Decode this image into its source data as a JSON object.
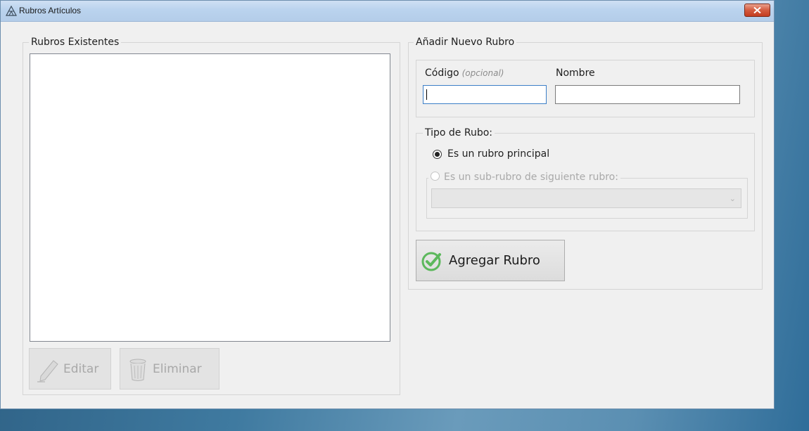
{
  "window": {
    "title": "Rubros Artículos"
  },
  "existing": {
    "legend": "Rubros Existentes",
    "edit_label": "Editar",
    "delete_label": "Eliminar"
  },
  "add_new": {
    "legend": "Añadir Nuevo Rubro",
    "code_label": "Código",
    "code_hint": "(opcional)",
    "name_label": "Nombre",
    "code_value": "",
    "name_value": "",
    "type_legend": "Tipo de Rubo:",
    "option_main": "Es un rubro principal",
    "option_sub": "Es un sub-rubro de siguiente rubro:",
    "selected_option": "Es un rubro principal",
    "parent_select_value": "",
    "add_button_label": "Agregar Rubro"
  },
  "colors": {
    "accent_green": "#5cb85c",
    "close_red": "#c33d20"
  }
}
